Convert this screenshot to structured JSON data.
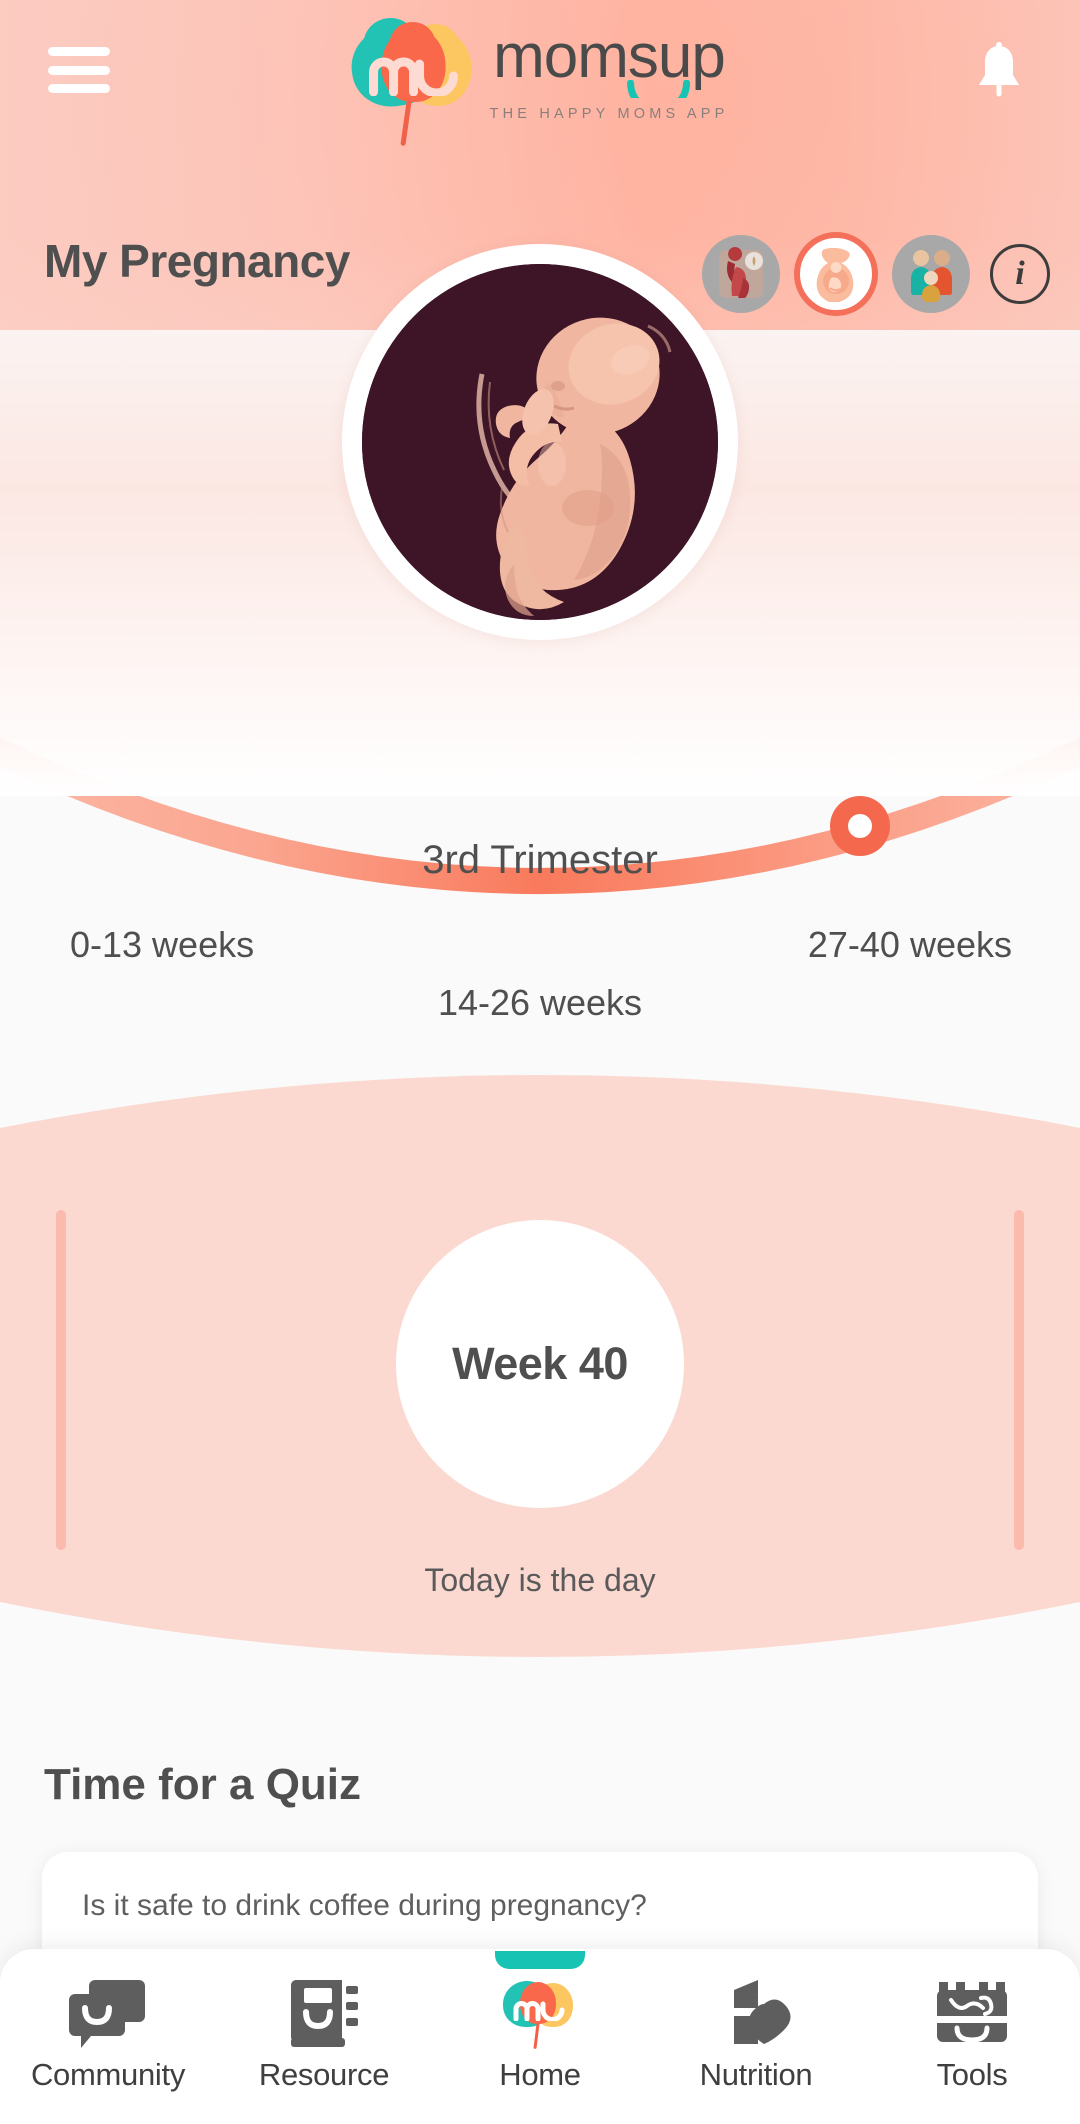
{
  "header": {
    "menu_icon": "hamburger-menu-icon",
    "brand_name": "moms",
    "brand_name_suffix": "up",
    "tagline": "THE HAPPY MOMS APP",
    "notification_icon": "bell-icon"
  },
  "title_row": {
    "title": "My Pregnancy",
    "info_label": "i",
    "tabs": [
      {
        "name": "pregnant-woman-tab",
        "active": false
      },
      {
        "name": "belly-fetus-tab",
        "active": true
      },
      {
        "name": "family-tab",
        "active": false
      }
    ]
  },
  "hero": {
    "image_name": "fetus-illustration"
  },
  "trimester": {
    "current": "3rd Trimester",
    "label_first": "0-13 weeks",
    "label_second": "14-26 weeks",
    "label_third": "27-40 weeks",
    "marker_position": "end"
  },
  "week_panel": {
    "week_label": "Week 40",
    "subtitle": "Today is the day",
    "ring_color": "#f6b453"
  },
  "quiz": {
    "title": "Time for a Quiz",
    "card_text": "Is it safe to drink coffee during pregnancy?"
  },
  "bottom_nav": {
    "items": [
      {
        "label": "Community",
        "icon": "chat-bubbles-icon",
        "active": false
      },
      {
        "label": "Resource",
        "icon": "book-icon",
        "active": false
      },
      {
        "label": "Home",
        "icon": "momsup-logo-icon",
        "active": true
      },
      {
        "label": "Nutrition",
        "icon": "milk-carton-icon",
        "active": false
      },
      {
        "label": "Tools",
        "icon": "toolbox-icon",
        "active": false
      }
    ]
  },
  "colors": {
    "accent_coral": "#f4684e",
    "accent_teal": "#17c3b2",
    "accent_amber": "#f6b453",
    "panel_pink": "#fbd9d1",
    "header_pink": "#fcc6bb"
  }
}
